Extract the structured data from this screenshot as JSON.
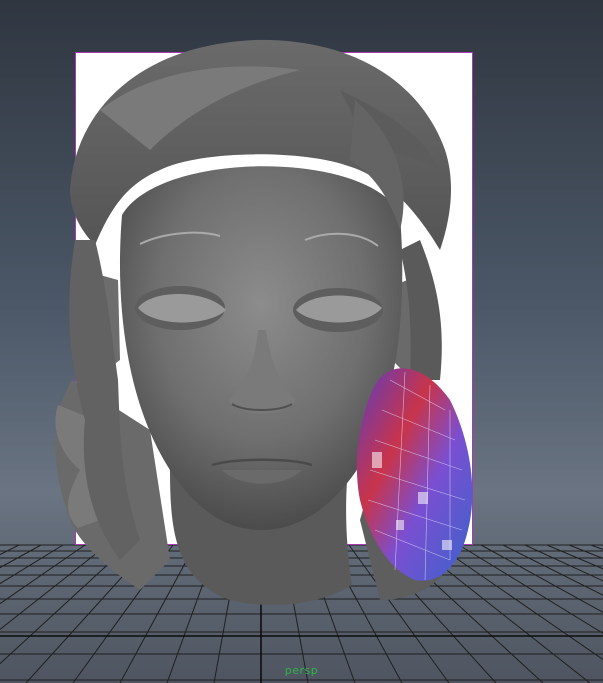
{
  "viewport": {
    "camera_name": "persp"
  },
  "colors": {
    "image_plane_border": "#a83bb3",
    "grid_line": "#1f1f1f",
    "camera_label": "#2fb34a"
  }
}
